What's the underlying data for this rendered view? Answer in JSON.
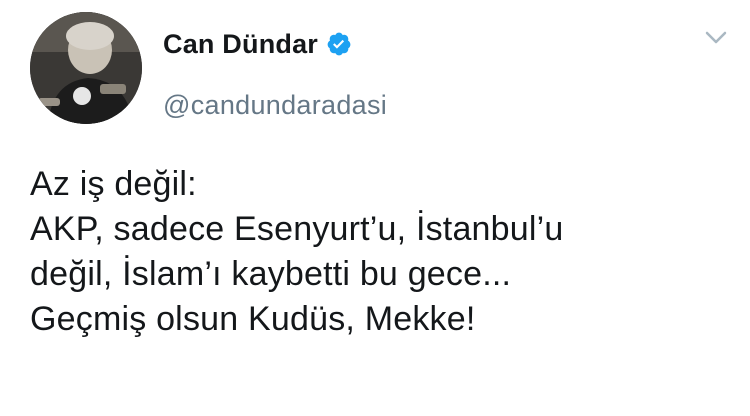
{
  "tweet": {
    "author": {
      "display_name": "Can Dündar",
      "handle": "@candundaradasi",
      "verified": true
    },
    "text_lines": [
      "Az iş değil:",
      "AKP, sadece Esenyurt’u, İstanbul’u",
      "değil, İslam’ı kaybetti bu gece...",
      "Geçmiş olsun Kudüs, Mekke!"
    ]
  },
  "icons": {
    "verified": "verified-badge-icon",
    "menu": "chevron-down-icon",
    "avatar": "profile-photo"
  },
  "colors": {
    "text_primary": "#14171a",
    "text_secondary": "#657786",
    "verified_blue": "#1da1f2",
    "background": "#ffffff"
  }
}
